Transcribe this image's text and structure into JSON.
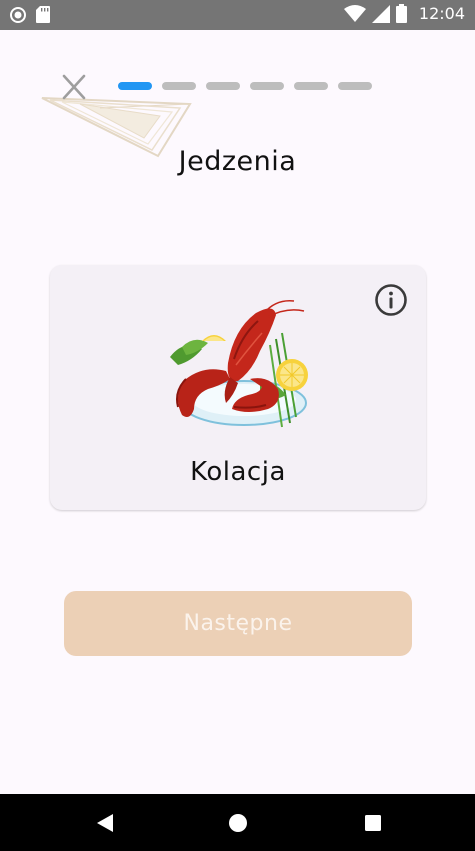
{
  "status_bar": {
    "time": "12:04"
  },
  "header": {
    "progress": {
      "total_steps": 6,
      "current_step": 1
    },
    "title": "Jedzenia"
  },
  "card": {
    "image_name": "lobster-dinner-image",
    "label": "Kolacja"
  },
  "actions": {
    "next_label": "Następne"
  },
  "colors": {
    "accent": "#2196f3",
    "inactive_segment": "#bdbdbd",
    "button_bg": "#ecd0b6",
    "button_text": "#fbf3ec",
    "background": "#fdf9fe"
  },
  "icons": {
    "close": "close-icon",
    "info": "info-icon",
    "nav_back": "back-triangle-icon",
    "nav_home": "home-circle-icon",
    "nav_recents": "recents-square-icon"
  }
}
